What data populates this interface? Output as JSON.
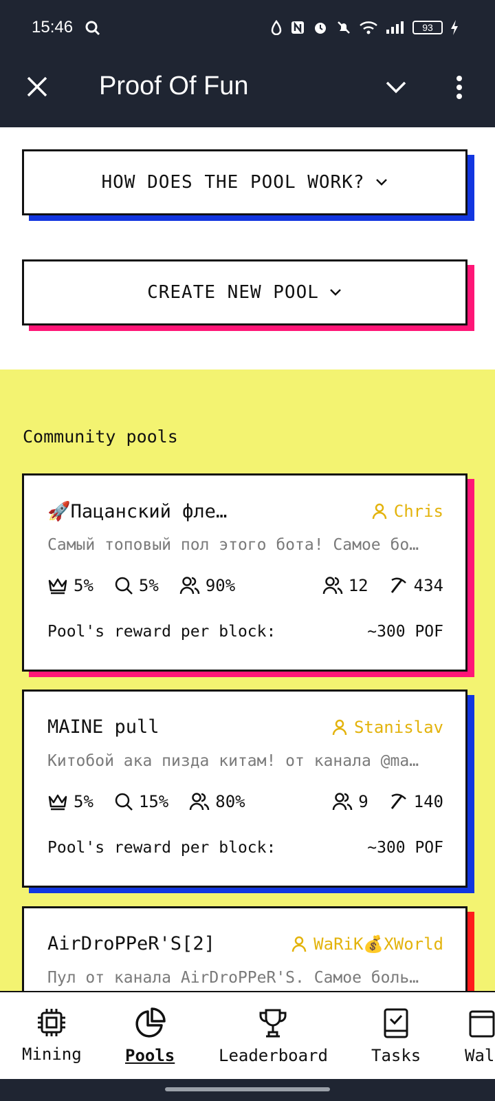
{
  "status": {
    "time": "15:46",
    "battery": "93"
  },
  "app": {
    "title": "Proof Of Fun"
  },
  "buttons": {
    "how_pool_works": "HOW DOES THE POOL WORK?",
    "create_pool": "CREATE NEW POOL"
  },
  "community": {
    "title": "Community pools",
    "reward_label": "Pool's reward per block:",
    "pools": [
      {
        "name": "🚀Пацанский фле…",
        "owner": "Chris",
        "description": "Самый топовый пол этого бота! Самое бо…",
        "crown": "5%",
        "search": "5%",
        "share": "90%",
        "members": "12",
        "mined": "434",
        "reward": "~300 POF"
      },
      {
        "name": "MAINE pull",
        "owner": "Stanislav",
        "description": "Китобой ака пизда китам! от канала @ma…",
        "crown": "5%",
        "search": "15%",
        "share": "80%",
        "members": "9",
        "mined": "140",
        "reward": "~300 POF"
      },
      {
        "name": "AirDroPPeR'S[2]",
        "owner": "WaRiK💰XWorld",
        "description": "Пул от канала AirDroPPeR'S. Самое боль…"
      }
    ]
  },
  "nav": {
    "items": [
      {
        "label": "Mining",
        "icon": "chip-icon"
      },
      {
        "label": "Pools",
        "icon": "pie-chart-icon"
      },
      {
        "label": "Leaderboard",
        "icon": "trophy-icon"
      },
      {
        "label": "Tasks",
        "icon": "checkbook-icon"
      },
      {
        "label": "Wal",
        "icon": "wallet-icon"
      }
    ]
  }
}
